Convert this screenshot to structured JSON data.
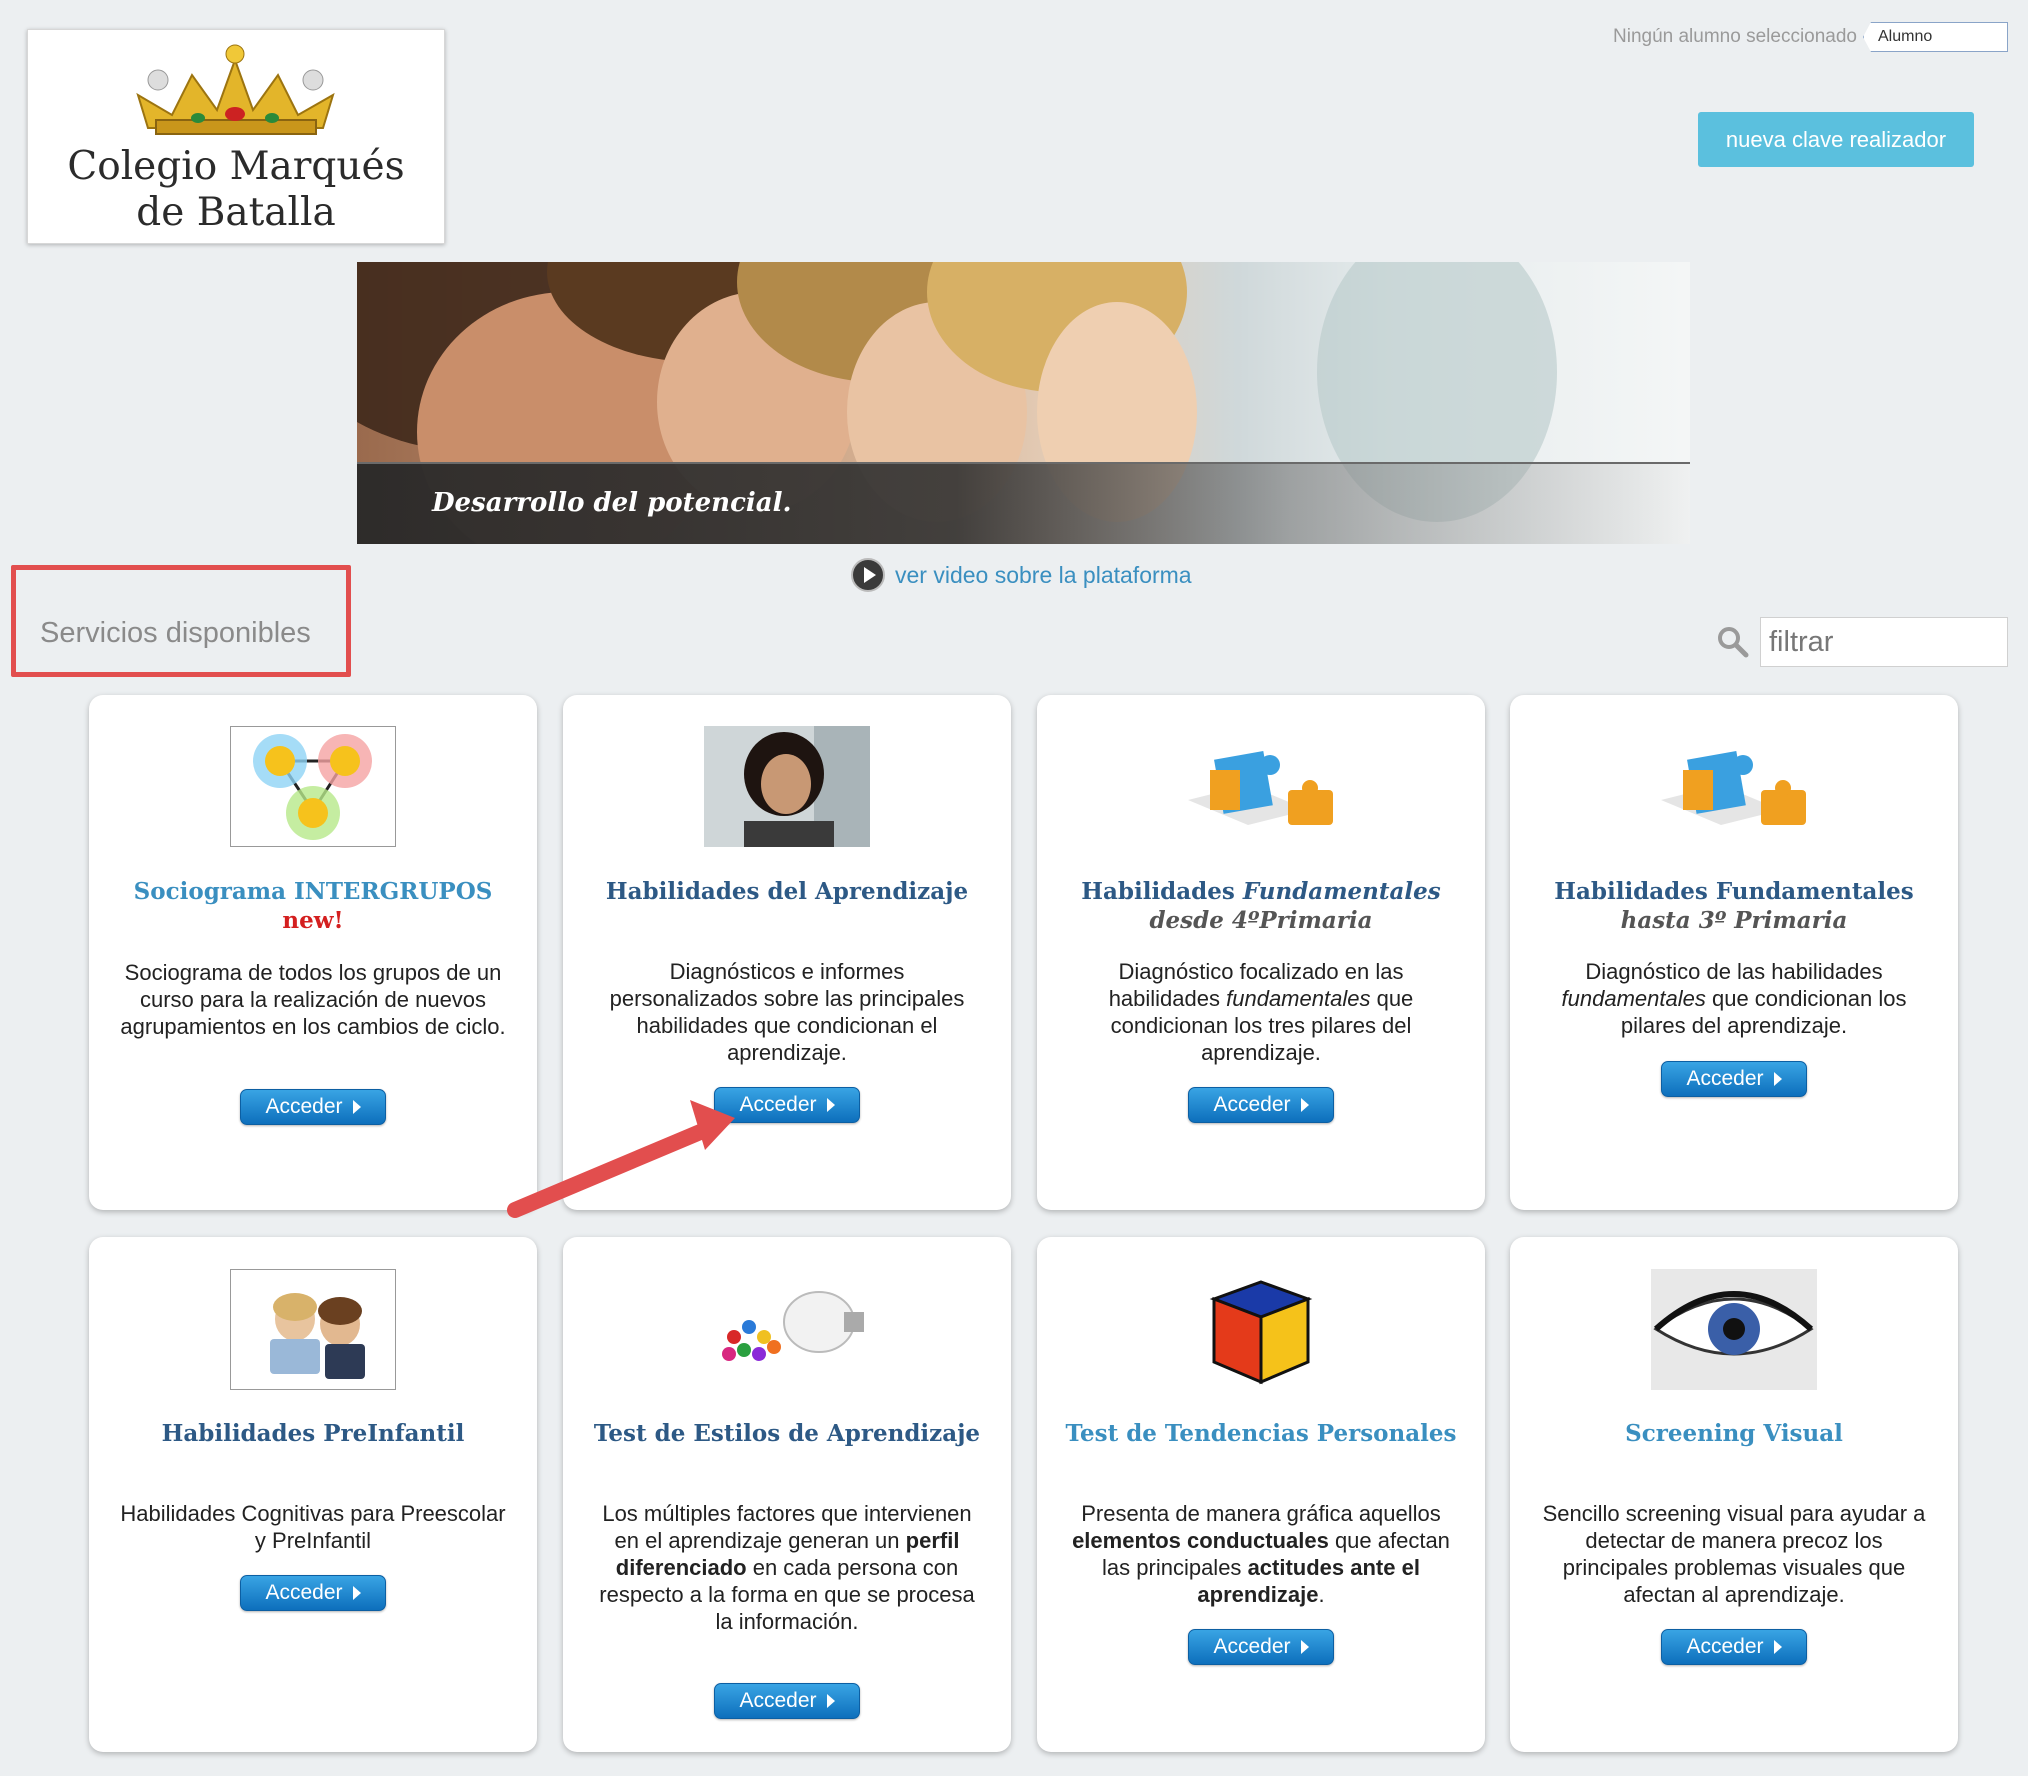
{
  "logo": {
    "line1": "Colegio Marqués",
    "line2": "de Batalla"
  },
  "header": {
    "student_status": "Ningún alumno seleccionado",
    "student_field": "Alumno",
    "new_key_button": "nueva clave realizador"
  },
  "banner": {
    "caption": "Desarrollo del potencial."
  },
  "video": {
    "link_text": "ver video sobre la plataforma"
  },
  "services": {
    "title": "Servicios disponibles",
    "filter_placeholder": "filtrar"
  },
  "accent_colors": {
    "link_blue": "#3a8fc0",
    "title_dark": "#2d5985",
    "new_red": "#d41f1f",
    "annotation_red": "#e24e4e"
  },
  "cards": [
    {
      "title_a": "Sociograma INTERGRUPOS",
      "title_b": "new!",
      "desc": "Sociograma de todos los grupos de un curso para la realización de nuevos agrupamientos en los cambios de ciclo.",
      "button": "Acceder"
    },
    {
      "title_a": "Habilidades del Aprendizaje",
      "desc": "Diagnósticos e informes personalizados sobre las principales habilidades que condicionan el aprendizaje.",
      "button": "Acceder"
    },
    {
      "title_a": "Habilidades",
      "title_a_em": "Fundamentales",
      "title_b": "desde 4ºPrimaria",
      "desc_1": "Diagnóstico focalizado en las habilidades",
      "desc_em": "fundamentales",
      "desc_2": "que condicionan los tres pilares del aprendizaje.",
      "button": "Acceder"
    },
    {
      "title_a": "Habilidades Fundamentales",
      "title_b": "hasta 3º Primaria",
      "desc_1": "Diagnóstico de las habilidades",
      "desc_em": "fundamentales",
      "desc_2": "que condicionan los pilares del aprendizaje.",
      "button": "Acceder"
    },
    {
      "title_a": "Habilidades PreInfantil",
      "desc": "Habilidades Cognitivas para Preescolar y PreInfantil",
      "button": "Acceder"
    },
    {
      "title_a": "Test de Estilos de Aprendizaje",
      "desc_1": "Los múltiples factores que intervienen en el aprendizaje generan un",
      "desc_bold": "perfil diferenciado",
      "desc_2": "en cada persona con respecto a la forma en que se procesa la información.",
      "button": "Acceder"
    },
    {
      "title_a": "Test de Tendencias Personales",
      "desc_1": "Presenta de manera gráfica aquellos",
      "desc_bold": "elementos conductuales",
      "desc_2": "que afectan las principales",
      "desc_bold2": "actitudes ante el aprendizaje",
      "desc_3": ".",
      "button": "Acceder"
    },
    {
      "title_a": "Screening Visual",
      "desc": "Sencillo screening visual para ayudar a detectar de manera precoz los principales problemas visuales que afectan al aprendizaje.",
      "button": "Acceder"
    }
  ]
}
